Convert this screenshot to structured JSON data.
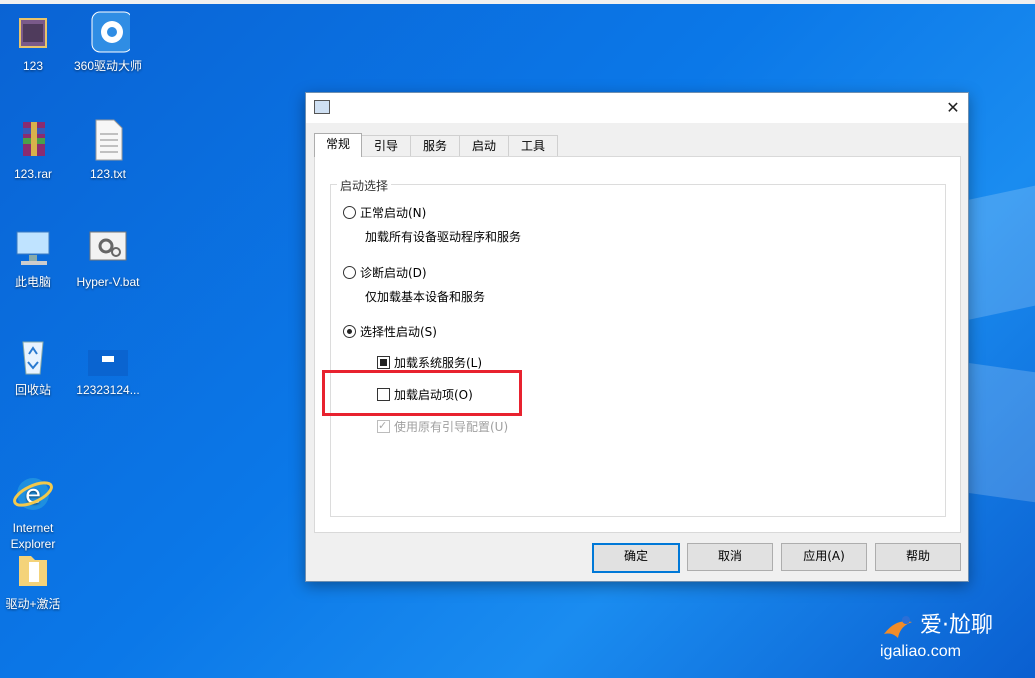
{
  "desktop": {
    "icons": [
      {
        "label": "123",
        "icon": "folder-icon"
      },
      {
        "label": "360驱动大师",
        "icon": "driver-master-icon"
      },
      {
        "label": "123.rar",
        "icon": "winrar-archive-icon"
      },
      {
        "label": "123.txt",
        "icon": "text-file-icon"
      },
      {
        "label": "此电脑",
        "icon": "computer-icon"
      },
      {
        "label": "Hyper-V.bat",
        "icon": "batch-file-icon"
      },
      {
        "label": "回收站",
        "icon": "recycle-bin-icon"
      },
      {
        "label": "12323124...",
        "icon": "screenshot-image-icon"
      },
      {
        "label": "Internet\nExplorer",
        "icon": "internet-explorer-icon"
      },
      {
        "label": "驱动+激活",
        "icon": "folder-icon"
      }
    ]
  },
  "dialog": {
    "close_symbol": "✕",
    "tabs": [
      "常规",
      "引导",
      "服务",
      "启动",
      "工具"
    ],
    "active_tab": "常规",
    "group_label": "启动选择",
    "options": {
      "normal": {
        "label": "正常启动(N)",
        "desc": "加载所有设备驱动程序和服务",
        "checked": false
      },
      "diagnostic": {
        "label": "诊断启动(D)",
        "desc": "仅加载基本设备和服务",
        "checked": false
      },
      "selective": {
        "label": "选择性启动(S)",
        "checked": true
      }
    },
    "sub_options": {
      "load_system_services": {
        "label": "加载系统服务(L)",
        "state": "indeterminate"
      },
      "load_startup_items": {
        "label": "加载启动项(O)",
        "state": "unchecked"
      },
      "use_original_boot": {
        "label": "使用原有引导配置(U)",
        "state": "checked-disabled"
      }
    },
    "buttons": {
      "ok": "确定",
      "cancel": "取消",
      "apply": "应用(A)",
      "help": "帮助"
    },
    "highlight_color": "#e8222f"
  },
  "watermark": {
    "brand": "爱·尬聊",
    "url": "igaliao.com"
  }
}
